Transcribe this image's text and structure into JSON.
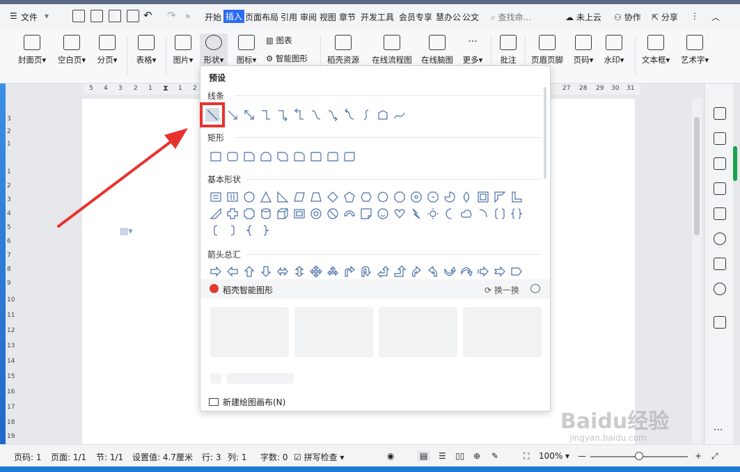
{
  "menubar": {
    "file": "文件",
    "tabs": [
      "开始",
      "插入",
      "页面布局",
      "引用",
      "审阅",
      "视图",
      "章节",
      "开发工具",
      "会员专享",
      "慧办公",
      "公文"
    ],
    "active_tab": "插入",
    "search_placeholder": "查找命...",
    "cloud": "未上云",
    "collab": "协作",
    "share": "分享"
  },
  "ribbon": {
    "cover": "封面页",
    "blank": "空白页",
    "page_break": "分页",
    "table": "表格",
    "picture": "图片",
    "shapes": "形状",
    "icons": "图标",
    "chart": "图表",
    "smart_art": "智能图形",
    "docer": "稻壳资源",
    "flowchart": "在线流程图",
    "mindmap": "在线脑图",
    "more": "更多",
    "comment": "批注",
    "header_footer": "页眉页脚",
    "page_num": "页码",
    "watermark": "水印",
    "textbox": "文本框",
    "wordart": "艺术字"
  },
  "ruler": {
    "left": [
      "5",
      "4",
      "3",
      "2",
      "1",
      "1",
      "2"
    ],
    "right": [
      "27",
      "28",
      "29",
      "30",
      "31"
    ]
  },
  "vruler": [
    "3",
    "2",
    "1",
    "1",
    "2",
    "3",
    "4",
    "5",
    "6",
    "7",
    "8",
    "9",
    "10",
    "11",
    "12",
    "13",
    "14",
    "15",
    "16",
    "17",
    "18",
    "19"
  ],
  "dropdown": {
    "header": "预设",
    "sections": {
      "lines": "线条",
      "rects": "矩形",
      "basic": "基本形状",
      "arrows": "箭头总汇"
    },
    "smart_title": "稻壳智能图形",
    "refresh": "换一换",
    "new_canvas": "新建绘图画布(N)"
  },
  "statusbar": {
    "page_code": "页码: 1",
    "pages": "页面: 1/1",
    "section": "节: 1/1",
    "setting": "设置值: 4.7厘米",
    "row": "行: 3",
    "col": "列: 1",
    "words": "字数: 0",
    "spell": "拼写检查",
    "zoom": "100%"
  },
  "watermark": {
    "brand": "Baidu经验",
    "url": "jingyan.baidu.com"
  },
  "colors": {
    "accent": "#2b6cf5",
    "highlight": "#e8322e",
    "shape_stroke": "#4a6ea8"
  }
}
